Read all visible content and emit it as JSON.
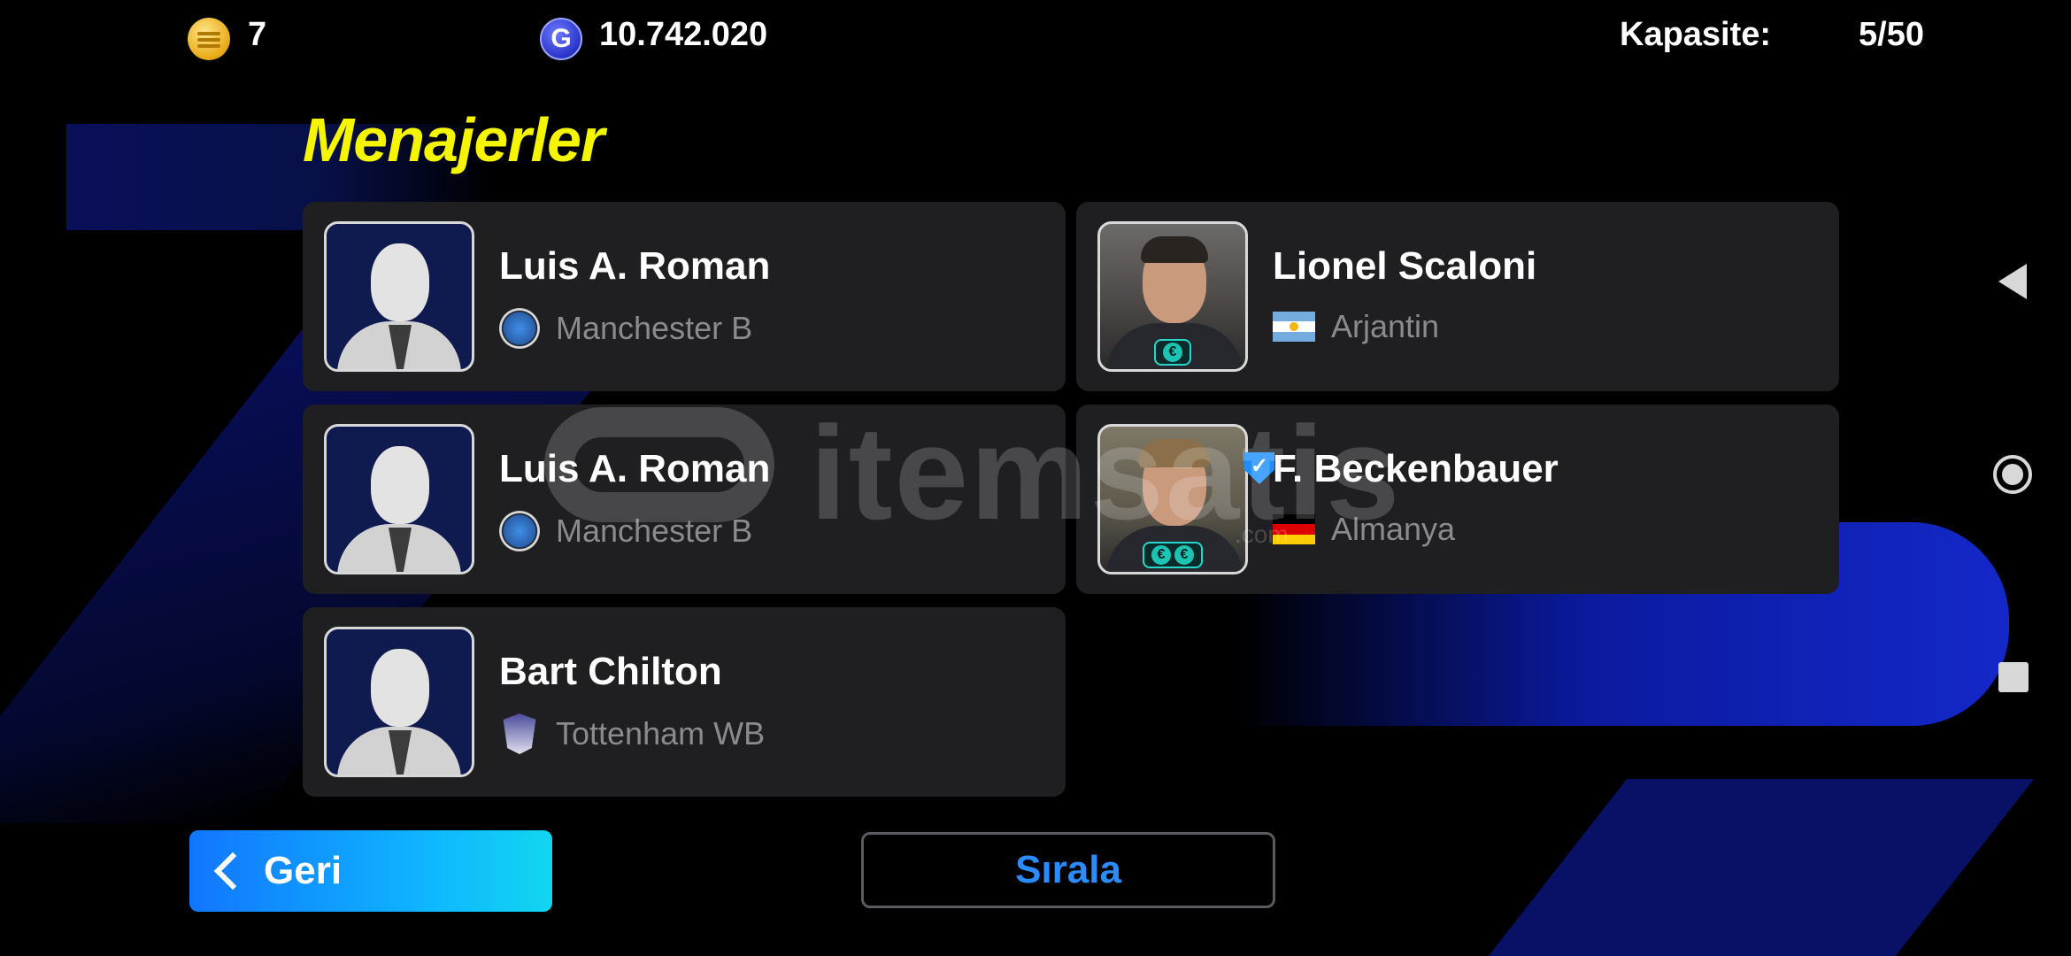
{
  "topbar": {
    "coins_value": "7",
    "gp_value": "10.742.020",
    "capacity_label": "Kapasite:",
    "capacity_value": "5/50"
  },
  "page_title": "Menajerler",
  "managers": [
    {
      "name": "Luis A. Roman",
      "team": "Manchester B",
      "icon": "club-badge-icon"
    },
    {
      "name": "Lionel Scaloni",
      "team": "Arjantin",
      "icon": "argentina-flag-icon"
    },
    {
      "name": "Luis A. Roman",
      "team": "Manchester B",
      "icon": "club-badge-icon"
    },
    {
      "name": "F. Beckenbauer",
      "team": "Almanya",
      "icon": "germany-flag-icon"
    },
    {
      "name": "Bart Chilton",
      "team": "Tottenham WB",
      "icon": "club-crest-icon"
    }
  ],
  "buttons": {
    "back_label": "Geri",
    "sort_label": "Sırala"
  },
  "watermark": {
    "text": "itemsatis",
    "sub": ".com"
  },
  "colors": {
    "title": "#f5f500",
    "accent_blue": "#1276ff",
    "sort_text": "#2a8cff",
    "card_bg": "#1f1f22"
  }
}
